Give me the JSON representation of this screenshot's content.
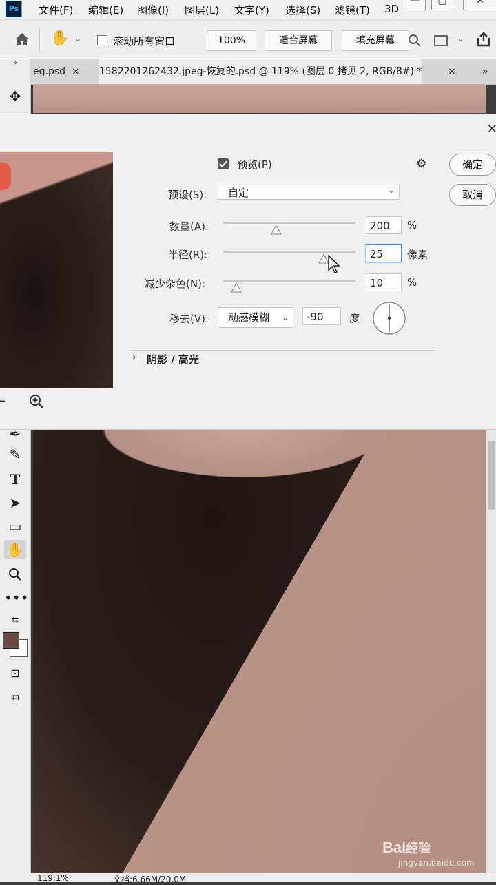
{
  "app": {
    "logo": "Ps",
    "menu": [
      "文件(F)",
      "编辑(E)",
      "图像(I)",
      "图层(L)",
      "文字(Y)",
      "选择(S)",
      "滤镜(T)",
      "3D"
    ]
  },
  "options_bar": {
    "scroll_all_label": "滚动所有窗口",
    "zoom_value": "100%",
    "fit_screen_label": "适合屏幕",
    "fill_screen_label": "填充屏幕"
  },
  "tabs": {
    "tab1": "eg.psd",
    "tab2": "1582201262432.jpeg-恢复的.psd @ 119% (图层 0 拷贝 2, RGB/8#) *",
    "close_glyph": "×",
    "overflow": "»"
  },
  "dialog": {
    "preview_label": "预览(P)",
    "ok_label": "确定",
    "cancel_label": "取消",
    "preset_label": "预设(S):",
    "preset_value": "自定",
    "amount_label": "数量(A):",
    "amount_value": "200",
    "amount_unit": "%",
    "amount_fraction": 0.4,
    "radius_label": "半径(R):",
    "radius_value": "25",
    "radius_unit": "像素",
    "radius_fraction": 0.76,
    "noise_label": "减少杂色(N):",
    "noise_value": "10",
    "noise_unit": "%",
    "noise_fraction": 0.1,
    "remove_label": "移去(V):",
    "remove_value": "动感模糊",
    "angle_value": "-90",
    "angle_unit": "度",
    "shadows_label": "阴影 / 高光",
    "close_glyph": "×"
  },
  "status": {
    "zoom": "119.1%",
    "doc": "文档:6.66M/20.0M"
  },
  "colors": {
    "foreground": "#6b4a42",
    "background": "#ffffff",
    "focus": "#4a8fd6"
  }
}
